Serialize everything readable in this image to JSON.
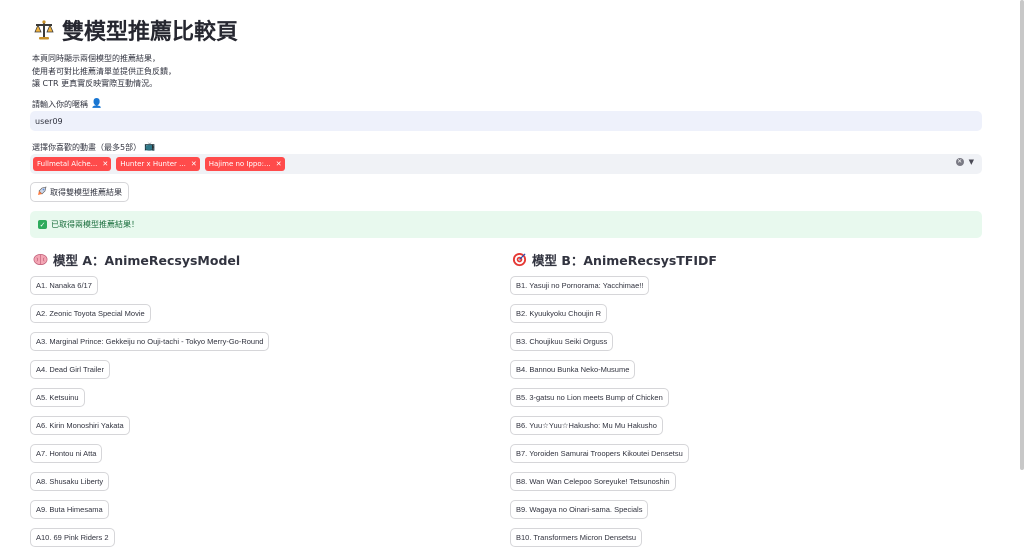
{
  "title": "雙模型推薦比較頁",
  "description": [
    "本頁同時顯示兩個模型的推薦結果，",
    "使用者可對比推薦清單並提供正負反饋，",
    "讓 CTR 更真實反映實際互動情況。"
  ],
  "username": {
    "label": "請輸入你的暱稱",
    "value": "user09"
  },
  "anime_select": {
    "label": "選擇你喜歡的動畫（最多5部）",
    "chips": [
      "Fullmetal Alche...",
      "Hunter x Hunter ...",
      "Hajime no Ippo:..."
    ]
  },
  "get_button_label": "取得雙模型推薦結果",
  "success_message": "已取得兩模型推薦結果！",
  "model_a": {
    "title": "模型 A：AnimeRecsysModel",
    "items": [
      "A1. Nanaka 6/17",
      "A2. Zeonic Toyota Special Movie",
      "A3. Marginal Prince: Gekkeiju no Ouji-tachi - Tokyo Merry-Go-Round",
      "A4. Dead Girl Trailer",
      "A5. Ketsuinu",
      "A6. Kirin Monoshiri Yakata",
      "A7. Hontou ni Atta",
      "A8. Shusaku Liberty",
      "A9. Buta Himesama",
      "A10. 69 Pink Riders 2"
    ]
  },
  "model_b": {
    "title": "模型 B：AnimeRecsysTFIDF",
    "items": [
      "B1. Yasuji no Pornorama: Yacchimae!!",
      "B2. Kyuukyoku Choujin R",
      "B3. Choujikuu Seiki Orguss",
      "B4. Bannou Bunka Neko-Musume",
      "B5. 3-gatsu no Lion meets Bump of Chicken",
      "B6. Yuu☆Yuu☆Hakusho: Mu Mu Hakusho",
      "B7. Yoroiden Samurai Troopers Kikoutei Densetsu",
      "B8. Wan Wan Celepoo Soreyuke! Tetsunoshin",
      "B9. Wagaya no Oinari-sama. Specials",
      "B10. Transformers Micron Densetsu"
    ]
  }
}
